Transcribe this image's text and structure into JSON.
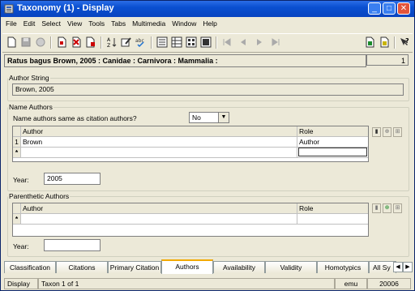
{
  "window": {
    "title": "Taxonomy (1) - Display"
  },
  "menu": [
    "File",
    "Edit",
    "Select",
    "View",
    "Tools",
    "Tabs",
    "Multimedia",
    "Window",
    "Help"
  ],
  "record_header": {
    "text": "Ratus bagus Brown, 2005 : Canidae : Carnivora : Mammalia :",
    "record_number": "1"
  },
  "author_string": {
    "legend": "Author String",
    "value": "Brown, 2005"
  },
  "name_authors": {
    "legend": "Name Authors",
    "same_as_label": "Name authors same as citation authors?",
    "same_as_value": "No",
    "columns": [
      "Author",
      "Role"
    ],
    "rows": [
      {
        "num": "1",
        "author": "Brown",
        "role": "Author"
      }
    ],
    "new_row_marker": "*",
    "year_label": "Year:",
    "year_value": "2005"
  },
  "parenthetic_authors": {
    "legend": "Parenthetic Authors",
    "columns": [
      "Author",
      "Role"
    ],
    "new_row_marker": "*",
    "year_label": "Year:",
    "year_value": ""
  },
  "tabs": [
    "Classification",
    "Citations",
    "Primary Citation",
    "Authors",
    "Availability",
    "Validity",
    "Homotypics",
    "All Sy"
  ],
  "active_tab": "Authors",
  "status": {
    "mode": "Display",
    "position": "Taxon 1 of 1",
    "user": "emu",
    "port": "20006"
  }
}
